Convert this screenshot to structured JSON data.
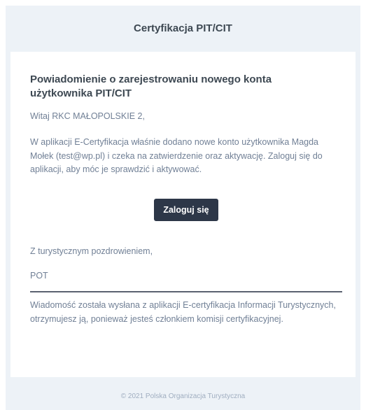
{
  "header": {
    "title": "Certyfikacja PIT/CIT"
  },
  "email": {
    "heading": "Powiadomienie o zarejestrowaniu nowego konta użytkownika PIT/CIT",
    "greeting": "Witaj RKC MAŁOPOLSKIE 2,",
    "body": "W aplikacji E-Certyfikacja właśnie dodano nowe konto użytkownika Magda Mołek (test@wp.pl) i czeka na zatwierdzenie oraz aktywację. Zaloguj się do aplikacji, aby móc je sprawdzić i aktywować.",
    "login_button": "Zaloguj się",
    "closing": "Z turystycznym pozdrowieniem,",
    "signature": "POT",
    "notice": "Wiadomość została wysłana z aplikacji E-certyfikacja Informacji Turystycznych, otrzymujesz ją, ponieważ jesteś członkiem komisji certyfikacyjnej."
  },
  "footer": {
    "copyright": "© 2021 Polska Organizacja Turystyczna"
  },
  "colors": {
    "button_bg": "#2d3748",
    "background": "#edf2f7",
    "text": "#718096",
    "heading": "#3d4852"
  }
}
